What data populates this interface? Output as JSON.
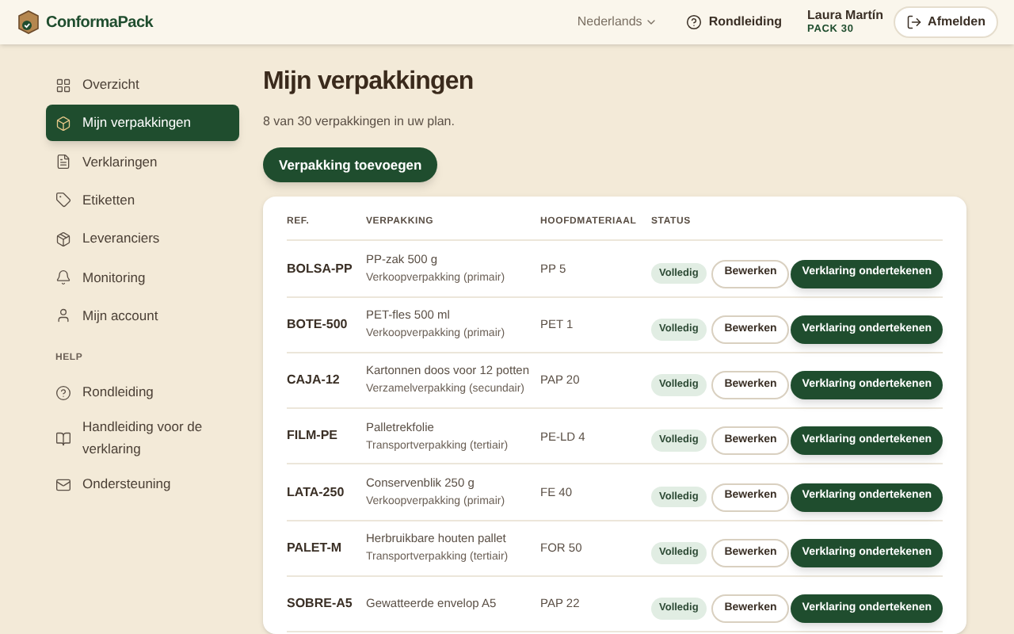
{
  "header": {
    "logo": "ConformaPack",
    "language": "Nederlands",
    "tour": "Rondleiding",
    "user": {
      "name": "Laura Martín",
      "plan": "PACK 30"
    },
    "logout": "Afmelden"
  },
  "sidebar": {
    "items": [
      {
        "label": "Overzicht",
        "selected": false
      },
      {
        "label": "Mijn verpakkingen",
        "selected": true
      },
      {
        "label": "Verklaringen",
        "selected": false
      },
      {
        "label": "Etiketten",
        "selected": false
      },
      {
        "label": "Leveranciers",
        "selected": false
      },
      {
        "label": "Monitoring",
        "selected": false
      },
      {
        "label": "Mijn account",
        "selected": false
      }
    ],
    "help_heading": "HELP",
    "help_items": [
      {
        "label": "Rondleiding"
      },
      {
        "label": "Handleiding voor de verklaring"
      },
      {
        "label": "Ondersteuning"
      }
    ]
  },
  "main": {
    "title": "Mijn verpakkingen",
    "subtitle": "8 van 30 verpakkingen in uw plan.",
    "add_button": "Verpakking toevoegen",
    "table": {
      "columns": [
        "REF.",
        "VERPAKKING",
        "HOOFDMATERIAAL",
        "STATUS"
      ],
      "rows": [
        {
          "ref": "BOLSA-PP",
          "name": "PP-zak 500 g",
          "type": "Verkoopverpakking (primair)",
          "material": "PP 5",
          "status": "Volledig",
          "edit": "Bewerken",
          "sign": "Verklaring ondertekenen"
        },
        {
          "ref": "BOTE-500",
          "name": "PET-fles 500 ml",
          "type": "Verkoopverpakking (primair)",
          "material": "PET 1",
          "status": "Volledig",
          "edit": "Bewerken",
          "sign": "Verklaring ondertekenen"
        },
        {
          "ref": "CAJA-12",
          "name": "Kartonnen doos voor 12 potten",
          "type": "Verzamelverpakking (secundair)",
          "material": "PAP 20",
          "status": "Volledig",
          "edit": "Bewerken",
          "sign": "Verklaring ondertekenen"
        },
        {
          "ref": "FILM-PE",
          "name": "Palletrekfolie",
          "type": "Transportverpakking (tertiair)",
          "material": "PE-LD 4",
          "status": "Volledig",
          "edit": "Bewerken",
          "sign": "Verklaring ondertekenen"
        },
        {
          "ref": "LATA-250",
          "name": "Conservenblik 250 g",
          "type": "Verkoopverpakking (primair)",
          "material": "FE 40",
          "status": "Volledig",
          "edit": "Bewerken",
          "sign": "Verklaring ondertekenen"
        },
        {
          "ref": "PALET-M",
          "name": "Herbruikbare houten pallet",
          "type": "Transportverpakking (tertiair)",
          "material": "FOR 50",
          "status": "Volledig",
          "edit": "Bewerken",
          "sign": "Verklaring ondertekenen"
        },
        {
          "ref": "SOBRE-A5",
          "name": "Gewatteerde envelop A5",
          "material": "PAP 22",
          "status": "Volledig",
          "edit": "Bewerken",
          "sign": "Verklaring ondertekenen"
        }
      ]
    }
  }
}
